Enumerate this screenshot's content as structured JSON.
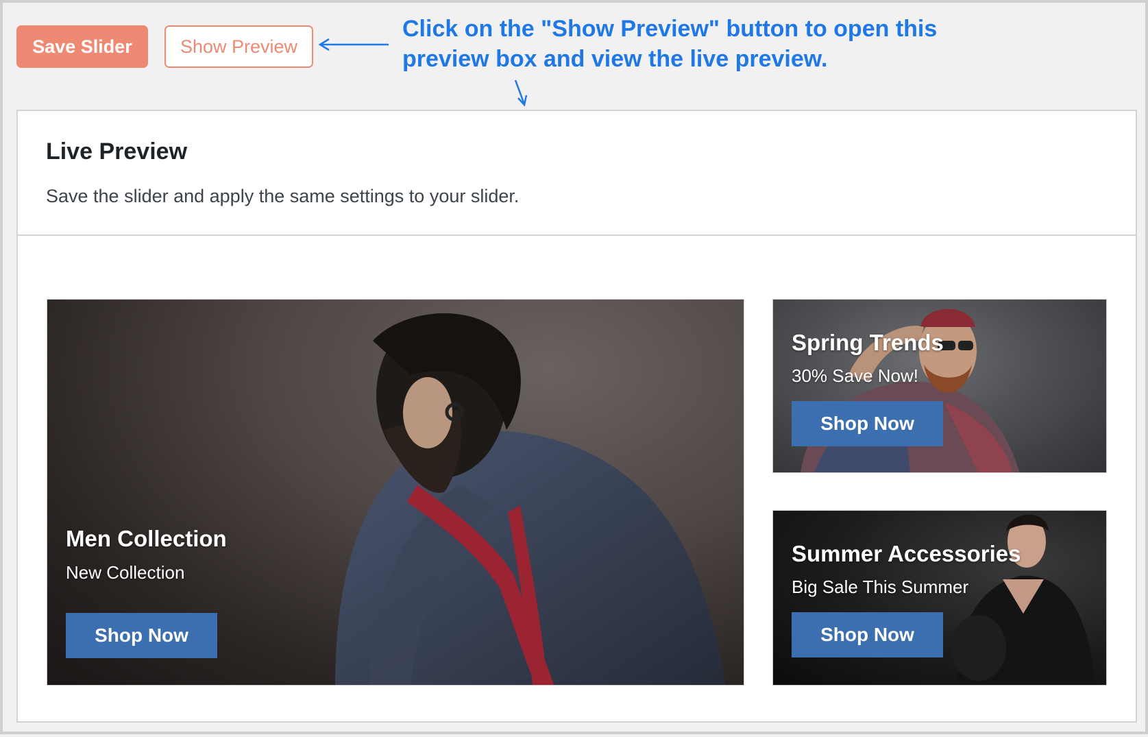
{
  "toolbar": {
    "save_label": "Save Slider",
    "preview_label": "Show Preview"
  },
  "annotation": {
    "line1": "Click on the \"Show Preview\" button to open this",
    "line2": "preview box and view the live preview."
  },
  "panel": {
    "title": "Live Preview",
    "description": "Save the slider and apply the same settings to your slider."
  },
  "banners": [
    {
      "title": "Men Collection",
      "subtitle": "New Collection",
      "button": "Shop Now"
    },
    {
      "title": "Spring Trends",
      "subtitle": "30% Save Now!",
      "button": "Shop Now"
    },
    {
      "title": "Summer Accessories",
      "subtitle": "Big Sale This Summer",
      "button": "Shop Now"
    }
  ],
  "colors": {
    "accent": "#ee8a74",
    "annotation": "#1f78e6",
    "shop_button": "#3c6fb0"
  },
  "icons": [
    "arrow-left-icon",
    "arrow-down-icon"
  ]
}
